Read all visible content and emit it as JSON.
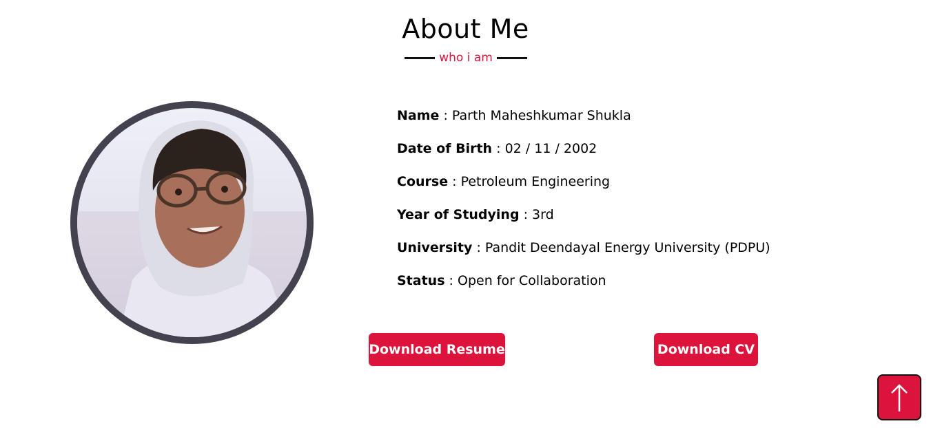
{
  "section": {
    "title": "About Me",
    "subtitle": "who i am"
  },
  "profile": {
    "photo_alt": "profile photo"
  },
  "info": [
    {
      "label": "Name",
      "value": " : Parth Maheshkumar Shukla"
    },
    {
      "label": "Date of Birth",
      "value": " : 02 / 11 / 2002"
    },
    {
      "label": "Course",
      "value": " : Petroleum Engineering"
    },
    {
      "label": "Year of Studying",
      "value": " : 3rd"
    },
    {
      "label": "University",
      "value": " : Pandit Deendayal Energy University (PDPU)"
    },
    {
      "label": "Status",
      "value": " : Open for Collaboration"
    }
  ],
  "buttons": {
    "download_resume": "Download Resume",
    "download_cv": "Download CV"
  },
  "scroll_top_icon": "arrow-up-icon",
  "colors": {
    "accent": "#dc143c",
    "ring": "#45424f",
    "text": "#000000"
  }
}
